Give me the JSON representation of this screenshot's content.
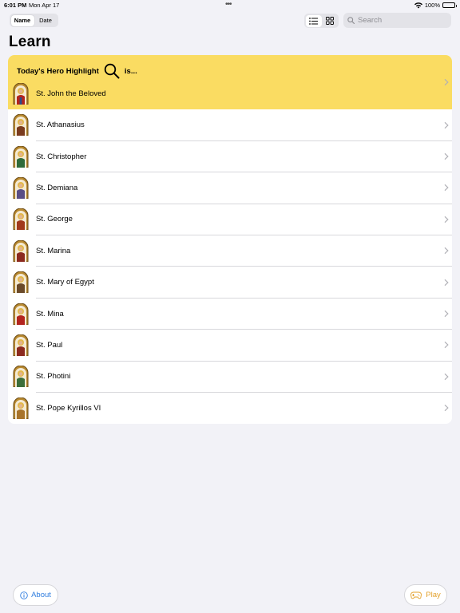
{
  "status_bar": {
    "time": "6:01 PM",
    "date": "Mon Apr 17",
    "battery": "100%",
    "battery_level": 1.0
  },
  "sort_control": {
    "options": [
      "Name",
      "Date"
    ],
    "selected": "Name"
  },
  "view_toggle": {
    "selected": "list",
    "icons": [
      "list-icon",
      "grid-icon"
    ]
  },
  "search": {
    "placeholder": "Search",
    "value": ""
  },
  "page_title": "Learn",
  "highlight": {
    "title_prefix": "Today's Hero Highlight",
    "title_suffix": "is...",
    "name": "St. John the Beloved",
    "background_color": "#fadc62"
  },
  "saints": [
    {
      "name": "St. Athanasius"
    },
    {
      "name": "St. Christopher"
    },
    {
      "name": "St. Demiana"
    },
    {
      "name": "St. George"
    },
    {
      "name": "St. Marina"
    },
    {
      "name": "St. Mary of Egypt"
    },
    {
      "name": "St. Mina"
    },
    {
      "name": "St. Paul"
    },
    {
      "name": "St. Photini"
    },
    {
      "name": "St. Pope Kyrillos VI"
    }
  ],
  "footer": {
    "about_label": "About",
    "play_label": "Play",
    "about_color": "#2f7ddf",
    "play_color": "#e3a12a"
  }
}
